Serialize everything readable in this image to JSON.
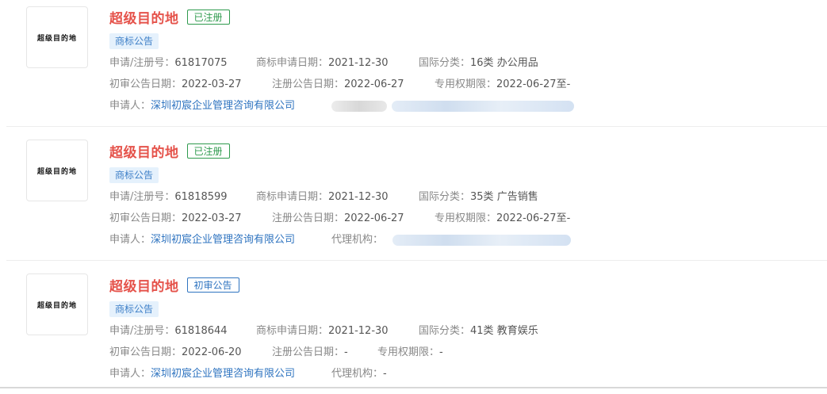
{
  "records": [
    {
      "logo_text": "超级目的地",
      "name": "超级目的地",
      "status": "已注册",
      "status_color": "#2e9a4d",
      "tag": "商标公告",
      "reg_no_label": "申请/注册号：",
      "reg_no": "61817075",
      "apply_date_label": "商标申请日期：",
      "apply_date": "2021-12-30",
      "class_label": "国际分类：",
      "class_value": "16类 办公用品",
      "prelim_label": "初审公告日期：",
      "prelim_date": "2022-03-27",
      "reg_pub_label": "注册公告日期：",
      "reg_pub_date": "2022-06-27",
      "exclusive_label": "专用权期限：",
      "exclusive_value": "2022-06-27至-",
      "applicant_label": "申请人：",
      "applicant": "深圳初宸企业管理咨询有限公司",
      "agency_label": "",
      "agency_value": ""
    },
    {
      "logo_text": "超级目的地",
      "name": "超级目的地",
      "status": "已注册",
      "status_color": "#2e9a4d",
      "tag": "商标公告",
      "reg_no_label": "申请/注册号：",
      "reg_no": "61818599",
      "apply_date_label": "商标申请日期：",
      "apply_date": "2021-12-30",
      "class_label": "国际分类：",
      "class_value": "35类 广告销售",
      "prelim_label": "初审公告日期：",
      "prelim_date": "2022-03-27",
      "reg_pub_label": "注册公告日期：",
      "reg_pub_date": "2022-06-27",
      "exclusive_label": "专用权期限：",
      "exclusive_value": "2022-06-27至-",
      "applicant_label": "申请人：",
      "applicant": "深圳初宸企业管理咨询有限公司",
      "agency_label": "代理机构：",
      "agency_value": ""
    },
    {
      "logo_text": "超级目的地",
      "name": "超级目的地",
      "status": "初审公告",
      "status_color": "#2f74c0",
      "tag": "商标公告",
      "reg_no_label": "申请/注册号：",
      "reg_no": "61818644",
      "apply_date_label": "商标申请日期：",
      "apply_date": "2021-12-30",
      "class_label": "国际分类：",
      "class_value": "41类 教育娱乐",
      "prelim_label": "初审公告日期：",
      "prelim_date": "2022-06-20",
      "reg_pub_label": "注册公告日期：",
      "reg_pub_date": "-",
      "exclusive_label": "专用权期限：",
      "exclusive_value": "-",
      "applicant_label": "申请人：",
      "applicant": "深圳初宸企业管理咨询有限公司",
      "agency_label": "代理机构：",
      "agency_value": "-"
    }
  ]
}
